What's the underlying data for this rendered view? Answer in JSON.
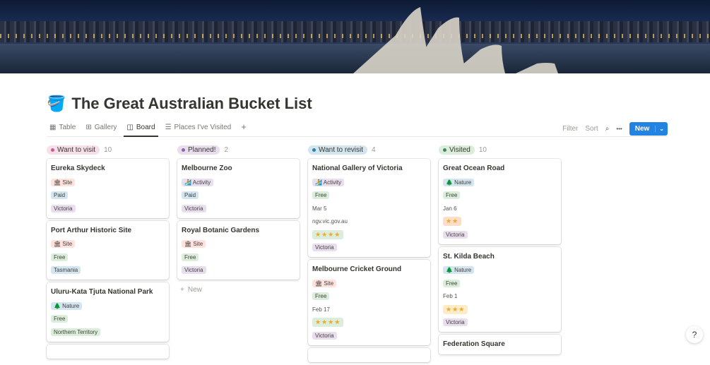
{
  "page": {
    "title": "The Great Australian Bucket List",
    "icon": "bucket-icon"
  },
  "tabs": [
    {
      "label": "Table",
      "icon": "table-icon"
    },
    {
      "label": "Gallery",
      "icon": "gallery-icon"
    },
    {
      "label": "Board",
      "icon": "board-icon",
      "active": true
    },
    {
      "label": "Places I've Visited",
      "icon": "list-icon"
    }
  ],
  "actions": {
    "filter": "Filter",
    "sort": "Sort",
    "more": "•••",
    "new": "New",
    "new_chevron": "⌄",
    "add_view": "+"
  },
  "colors": {
    "red": "#ffe2dd",
    "blue": "#d3e5ef",
    "purple": "#e8deee",
    "green": "#dbeddb",
    "orange": "#fadec9",
    "yellow": "#fdecc8",
    "accent": "#2383e2"
  },
  "columns": [
    {
      "name": "Want to visit",
      "count": "10",
      "bg": "#f5e0e9",
      "dot": "#d15796",
      "cards": [
        {
          "name": "Eureka Skydeck",
          "fields": [
            {
              "t": "🏛 Site",
              "c": "red"
            },
            {
              "t": "Paid",
              "c": "blue"
            },
            {
              "t": "Victoria",
              "c": "purple"
            }
          ]
        },
        {
          "name": "Port Arthur Historic Site",
          "fields": [
            {
              "t": "🏛 Site",
              "c": "red"
            },
            {
              "t": "Free",
              "c": "green"
            },
            {
              "t": "Tasmania",
              "c": "blue"
            }
          ]
        },
        {
          "name": "Uluru-Kata Tjuta National Park",
          "fields": [
            {
              "t": "🌲 Nature",
              "c": "blue"
            },
            {
              "t": "Free",
              "c": "green"
            },
            {
              "t": "Northern Territory",
              "c": "green"
            }
          ]
        },
        {
          "name": "",
          "fields": []
        }
      ],
      "new": ""
    },
    {
      "name": "Planned!",
      "count": "2",
      "bg": "#e8deee",
      "dot": "#9065b0",
      "cards": [
        {
          "name": "Melbourne Zoo",
          "fields": [
            {
              "t": "🏄 Activity",
              "c": "purple"
            },
            {
              "t": "Paid",
              "c": "blue"
            },
            {
              "t": "Victoria",
              "c": "purple"
            }
          ]
        },
        {
          "name": "Royal Botanic Gardens",
          "fields": [
            {
              "t": "🏛 Site",
              "c": "red"
            },
            {
              "t": "Free",
              "c": "green"
            },
            {
              "t": "Victoria",
              "c": "purple"
            }
          ]
        }
      ],
      "new": "New"
    },
    {
      "name": "Want to revisit",
      "count": "4",
      "bg": "#d3e5ef",
      "dot": "#337ea9",
      "cards": [
        {
          "name": "National Gallery of Victoria",
          "fields": [
            {
              "t": "🏄 Activity",
              "c": "purple"
            },
            {
              "t": "Free",
              "c": "green"
            },
            {
              "t": "Mar 5"
            },
            {
              "t": "ngv.vic.gov.au"
            },
            {
              "t": "★★★★",
              "c": "green",
              "star": true
            },
            {
              "t": "Victoria",
              "c": "purple"
            }
          ]
        },
        {
          "name": "Melbourne Cricket Ground",
          "fields": [
            {
              "t": "🏛 Site",
              "c": "red"
            },
            {
              "t": "Free",
              "c": "green"
            },
            {
              "t": "Feb 17"
            },
            {
              "t": "★★★★",
              "c": "green",
              "star": true
            },
            {
              "t": "Victoria",
              "c": "purple"
            }
          ]
        },
        {
          "name": "",
          "fields": []
        }
      ],
      "new": ""
    },
    {
      "name": "Visited",
      "count": "10",
      "bg": "#dbeddb",
      "dot": "#448361",
      "cards": [
        {
          "name": "Great Ocean Road",
          "fields": [
            {
              "t": "🌲 Nature",
              "c": "blue"
            },
            {
              "t": "Free",
              "c": "green"
            },
            {
              "t": "Jan 6"
            },
            {
              "t": "★★",
              "c": "orange",
              "star": true
            },
            {
              "t": "Victoria",
              "c": "purple"
            }
          ]
        },
        {
          "name": "St. Kilda Beach",
          "fields": [
            {
              "t": "🌲 Nature",
              "c": "blue"
            },
            {
              "t": "Free",
              "c": "green"
            },
            {
              "t": "Feb 1"
            },
            {
              "t": "★★★",
              "c": "yellow",
              "star": true
            },
            {
              "t": "Victoria",
              "c": "purple"
            }
          ]
        },
        {
          "name": "Federation Square",
          "fields": []
        }
      ],
      "new": ""
    }
  ],
  "help": "?"
}
